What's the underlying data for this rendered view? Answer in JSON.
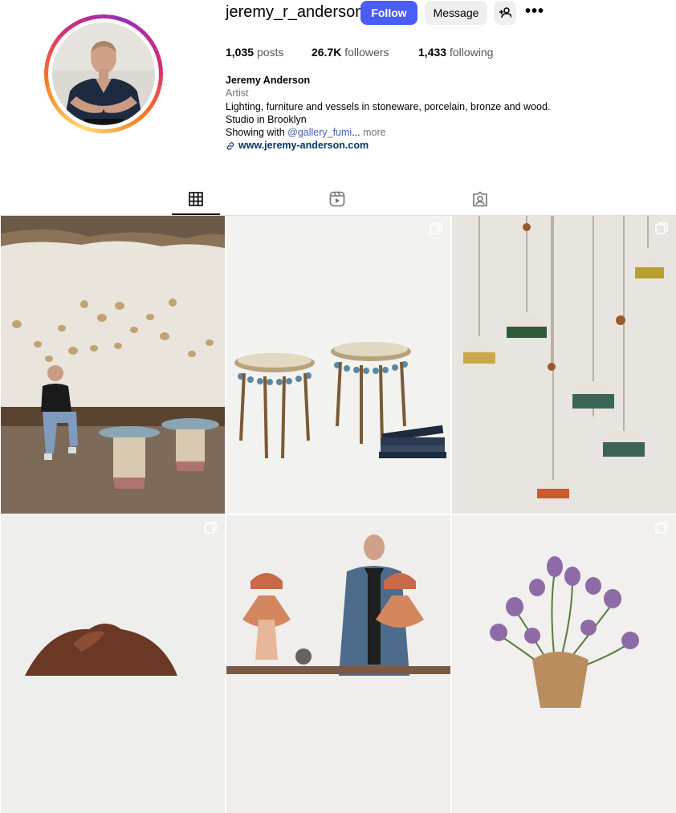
{
  "profile": {
    "username": "jeremy_r_anderson",
    "follow_label": "Follow",
    "message_label": "Message",
    "posts_count": "1,035",
    "posts_label": "posts",
    "followers_count": "26.7K",
    "followers_label": "followers",
    "following_count": "1,433",
    "following_label": "following",
    "full_name": "Jeremy Anderson",
    "category": "Artist",
    "bio_line1": "Lighting, furniture and vessels in stoneware, porcelain, bronze and wood.",
    "bio_line2": "Studio in Brooklyn",
    "bio_line3_prefix": "Showing with ",
    "bio_tag": "@gallery_fumi",
    "bio_ellipsis": "...",
    "more_label": "more",
    "website": "www.jeremy-anderson.com"
  },
  "tabs": [
    {
      "icon": "grid-icon",
      "active": true
    },
    {
      "icon": "reels-icon",
      "active": false
    },
    {
      "icon": "tagged-icon",
      "active": false
    }
  ],
  "colors": {
    "follow_button": "#4a5df9",
    "secondary_button": "#efefef",
    "link": "#00376b",
    "tag": "#4661b0",
    "muted": "#737373"
  },
  "posts": [
    {
      "subject": "artist seated in gallery with ceramic pendant lights and tables",
      "multi": false
    },
    {
      "subject": "two round side tables with fringe",
      "multi": true
    },
    {
      "subject": "hanging fringed ceramic pendant lamps",
      "multi": true
    },
    {
      "subject": "brown ceramic vessel",
      "multi": true
    },
    {
      "subject": "artist with striped ceramic lamps",
      "multi": false
    },
    {
      "subject": "purple tulips in ceramic vessel",
      "multi": true
    }
  ]
}
